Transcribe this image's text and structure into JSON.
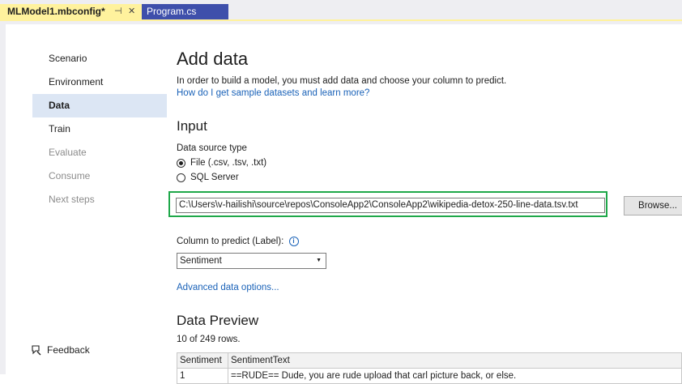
{
  "tabs": {
    "active_label": "MLModel1.mbconfig*",
    "pin_glyph": "⊣",
    "close_glyph": "✕",
    "inactive_label": "Program.cs"
  },
  "nav": {
    "items": [
      {
        "label": "Scenario",
        "state": "normal"
      },
      {
        "label": "Environment",
        "state": "normal"
      },
      {
        "label": "Data",
        "state": "selected"
      },
      {
        "label": "Train",
        "state": "normal"
      },
      {
        "label": "Evaluate",
        "state": "disabled"
      },
      {
        "label": "Consume",
        "state": "disabled"
      },
      {
        "label": "Next steps",
        "state": "disabled"
      }
    ],
    "feedback_label": "Feedback"
  },
  "main": {
    "title": "Add data",
    "description": "In order to build a model, you must add data and choose your column to predict.",
    "sample_link": "How do I get sample datasets and learn more?",
    "input_heading": "Input",
    "data_source_label": "Data source type",
    "radio_file_label": "File (.csv, .tsv, .txt)",
    "radio_sql_label": "SQL Server",
    "file_path": "C:\\Users\\v-hailishi\\source\\repos\\ConsoleApp2\\ConsoleApp2\\wikipedia-detox-250-line-data.tsv.txt",
    "browse_label": "Browse...",
    "column_label": "Column to predict (Label):",
    "info_glyph": "i",
    "column_selected": "Sentiment",
    "advanced_link": "Advanced data options...",
    "preview_heading": "Data Preview",
    "rows_count": "10 of 249 rows.",
    "table": {
      "headers": [
        "Sentiment",
        "SentimentText"
      ],
      "rows": [
        [
          "1",
          "==RUDE== Dude, you are rude upload that carl picture back, or else."
        ]
      ]
    }
  },
  "colors": {
    "active_tab": "#fff29d",
    "inactive_tab": "#3e4fab",
    "nav_selected": "#dce6f4",
    "highlight_box": "#1fa84a",
    "link": "#1a62b8"
  }
}
